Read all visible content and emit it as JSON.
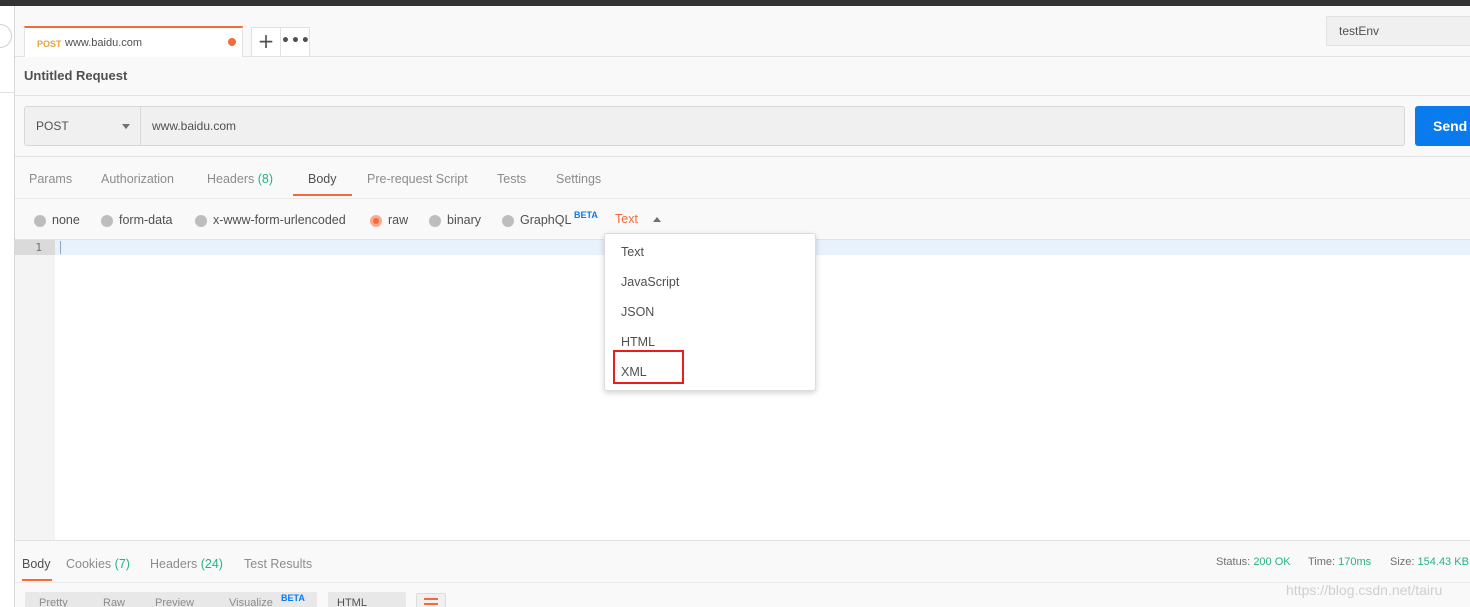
{
  "tab": {
    "method": "POST",
    "url": "www.baidu.com"
  },
  "environment": "testEnv",
  "request_name": "Untitled Request",
  "url_bar": {
    "method": "POST",
    "url": "www.baidu.com",
    "send_label": "Send"
  },
  "request_tabs": [
    {
      "label": "Params",
      "count": ""
    },
    {
      "label": "Authorization",
      "count": ""
    },
    {
      "label": "Headers",
      "count": "(8)"
    },
    {
      "label": "Body",
      "count": ""
    },
    {
      "label": "Pre-request Script",
      "count": ""
    },
    {
      "label": "Tests",
      "count": ""
    },
    {
      "label": "Settings",
      "count": ""
    }
  ],
  "body_types": [
    "none",
    "form-data",
    "x-www-form-urlencoded",
    "raw",
    "binary",
    "GraphQL"
  ],
  "beta_label": "BETA",
  "selected_body_type": "raw",
  "raw_type": "Text",
  "editor": {
    "line_numbers": [
      "1"
    ]
  },
  "raw_type_options": [
    "Text",
    "JavaScript",
    "JSON",
    "HTML",
    "XML"
  ],
  "highlighted_option": "XML",
  "response_tabs": [
    {
      "label": "Body",
      "count": ""
    },
    {
      "label": "Cookies",
      "count": "(7)"
    },
    {
      "label": "Headers",
      "count": "(24)"
    },
    {
      "label": "Test Results",
      "count": ""
    }
  ],
  "status": {
    "status_label": "Status:",
    "status_value": "200 OK",
    "time_label": "Time:",
    "time_value": "170ms",
    "size_label": "Size:",
    "size_value": "154.43 KB"
  },
  "response_view_tabs": [
    "Pretty",
    "Raw",
    "Preview",
    "Visualize"
  ],
  "response_format": "HTML",
  "watermark": "https://blog.csdn.net/tairu",
  "colors": {
    "accent": "#f26b3a",
    "send": "#097bed",
    "count": "#26b47f",
    "highlight_box": "#e81d1d"
  }
}
